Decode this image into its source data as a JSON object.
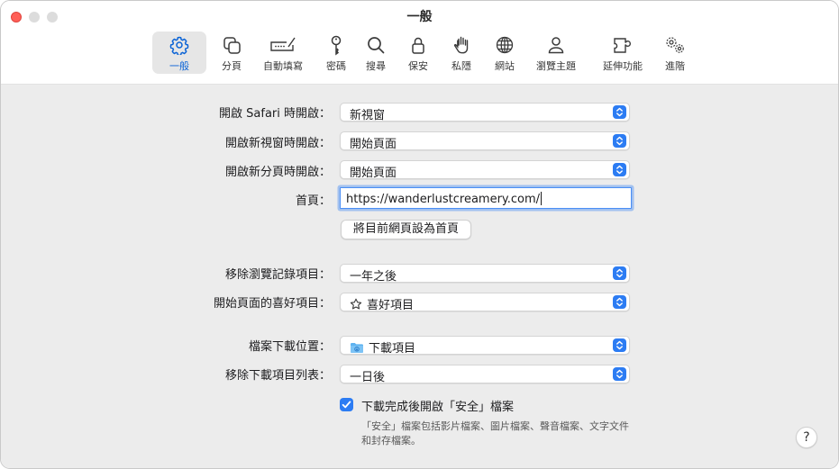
{
  "window": {
    "title": "一般"
  },
  "tabs": [
    {
      "id": "general",
      "label": "一般",
      "icon": "gear-icon",
      "selected": true
    },
    {
      "id": "tabs",
      "label": "分頁",
      "icon": "tabs-icon",
      "selected": false
    },
    {
      "id": "autofill",
      "label": "自動填寫",
      "icon": "pencil-field-icon",
      "selected": false
    },
    {
      "id": "passwords",
      "label": "密碼",
      "icon": "key-icon",
      "selected": false
    },
    {
      "id": "search",
      "label": "搜尋",
      "icon": "magnifier-icon",
      "selected": false
    },
    {
      "id": "security",
      "label": "保安",
      "icon": "lock-icon",
      "selected": false
    },
    {
      "id": "privacy",
      "label": "私隱",
      "icon": "hand-icon",
      "selected": false
    },
    {
      "id": "websites",
      "label": "網站",
      "icon": "globe-icon",
      "selected": false
    },
    {
      "id": "profiles",
      "label": "瀏覽主題",
      "icon": "person-icon",
      "selected": false
    },
    {
      "id": "extensions",
      "label": "延伸功能",
      "icon": "puzzle-icon",
      "selected": false
    },
    {
      "id": "advanced",
      "label": "進階",
      "icon": "gears-icon",
      "selected": false
    }
  ],
  "settings": {
    "safari_opens_with": {
      "label": "開啟 Safari 時開啟：",
      "value": "新視窗"
    },
    "new_windows_open_with": {
      "label": "開啟新視窗時開啟：",
      "value": "開始頁面"
    },
    "new_tabs_open_with": {
      "label": "開啟新分頁時開啟：",
      "value": "開始頁面"
    },
    "homepage": {
      "label": "首頁：",
      "value": "https://wanderlustcreamery.com/"
    },
    "set_current_page_button": "將目前網頁設為首頁",
    "remove_history_items": {
      "label": "移除瀏覽記錄項目：",
      "value": "一年之後"
    },
    "favorites_shows": {
      "label": "開始頁面的喜好項目：",
      "value": "喜好項目",
      "icon": "star-outline-icon"
    },
    "file_download_location": {
      "label": "檔案下載位置：",
      "value": "下載項目",
      "icon": "folder-download-icon"
    },
    "remove_download_list_items": {
      "label": "移除下載項目列表：",
      "value": "一日後"
    },
    "open_safe_files": {
      "label": "下載完成後開啟「安全」檔案",
      "checked": true,
      "note": "「安全」檔案包括影片檔案、圖片檔案、聲音檔案、文字文件和封存檔案。"
    }
  },
  "help_button": "?",
  "colors": {
    "accent": "#2c7cf3",
    "close": "#ff5f57",
    "content_bg": "#ececec"
  }
}
